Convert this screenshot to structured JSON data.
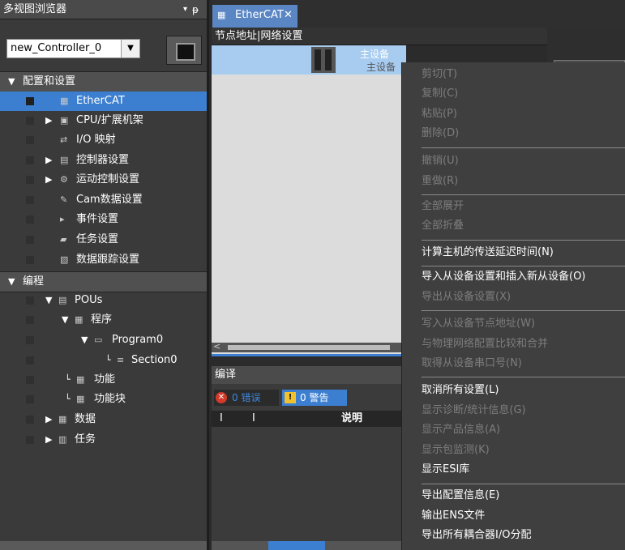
{
  "left_panel": {
    "title": "多视图浏览器",
    "pin_glyph": "▾",
    "pin2_glyph": "ᵽ",
    "controller": "new_Controller_0",
    "controller_arrow": "▼",
    "tree": [
      {
        "label": "配置和设置",
        "twisty": "▼",
        "icon": "",
        "kind": "header"
      },
      {
        "label": "EtherCAT",
        "twisty": "",
        "icon": "▦",
        "kind": "selected"
      },
      {
        "label": "CPU/扩展机架",
        "twisty": "▶",
        "icon": "▣"
      },
      {
        "label": "I/O 映射",
        "twisty": "",
        "icon": "⇄"
      },
      {
        "label": "控制器设置",
        "twisty": "▶",
        "icon": "▤"
      },
      {
        "label": "运动控制设置",
        "twisty": "▶",
        "icon": "⚙"
      },
      {
        "label": "Cam数据设置",
        "twisty": "",
        "icon": "✎"
      },
      {
        "label": "事件设置",
        "twisty": "",
        "icon": "▸"
      },
      {
        "label": "任务设置",
        "twisty": "",
        "icon": "▰"
      },
      {
        "label": "数据跟踪设置",
        "twisty": "",
        "icon": "▧"
      },
      {
        "label": "编程",
        "twisty": "▼",
        "icon": "",
        "kind": "header"
      },
      {
        "label": "POUs",
        "twisty": "▼",
        "icon": "▤"
      },
      {
        "label": "程序",
        "twisty": "▼",
        "icon": "▦"
      },
      {
        "label": "Program0",
        "twisty": "▼",
        "icon": "▭"
      },
      {
        "label": "Section0",
        "twisty": "└",
        "icon": "≡"
      },
      {
        "label": "功能",
        "twisty": "└",
        "icon": "▦"
      },
      {
        "label": "功能块",
        "twisty": "└",
        "icon": "▦"
      },
      {
        "label": "数据",
        "twisty": "▶",
        "icon": "▦"
      },
      {
        "label": "任务",
        "twisty": "▶",
        "icon": "▥"
      }
    ]
  },
  "tab": {
    "label": "EtherCAT",
    "close": "✕",
    "icon": "▦"
  },
  "nodes_bar": "节点地址|网络设置",
  "master": {
    "label1": "主设备",
    "label2": "主设备"
  },
  "scroll_left": "<",
  "compile": {
    "title": "编译",
    "errors_label": "0 错误",
    "errors_icon": "✕",
    "warnings_label": "0 警告",
    "warnings_icon": "!",
    "col1": "I",
    "col2": "I",
    "col3": "说明"
  },
  "context_menu": {
    "items": [
      {
        "label": "剪切(T)",
        "enabled": false
      },
      {
        "label": "复制(C)",
        "enabled": false
      },
      {
        "label": "粘贴(P)",
        "enabled": false
      },
      {
        "label": "删除(D)",
        "enabled": false
      },
      {
        "label": "撤销(U)",
        "enabled": false
      },
      {
        "label": "重做(R)",
        "enabled": false
      },
      {
        "label": "全部展开",
        "enabled": false
      },
      {
        "label": "全部折叠",
        "enabled": false
      },
      {
        "label": "计算主机的传送延迟时间(N)",
        "enabled": true
      },
      {
        "label": "导入从设备设置和插入新从设备(O)",
        "enabled": true
      },
      {
        "label": "导出从设备设置(X)",
        "enabled": false
      },
      {
        "label": "写入从设备节点地址(W)",
        "enabled": false
      },
      {
        "label": "与物理网络配置比较和合并",
        "enabled": false
      },
      {
        "label": "取得从设备串口号(N)",
        "enabled": false
      },
      {
        "label": "取消所有设置(L)",
        "enabled": true
      },
      {
        "label": "显示诊断/统计信息(G)",
        "enabled": false
      },
      {
        "label": "显示产品信息(A)",
        "enabled": false
      },
      {
        "label": "显示包监测(K)",
        "enabled": false
      },
      {
        "label": "显示ESI库",
        "enabled": true
      },
      {
        "label": "导出配置信息(E)",
        "enabled": true
      },
      {
        "label": "输出ENS文件",
        "enabled": true
      },
      {
        "label": "导出所有耦合器I/O分配",
        "enabled": true
      }
    ]
  },
  "colors": {
    "accent": "#3c7fd0",
    "menu_bg": "#3f3f3f",
    "disabled_text": "#7d7d7d"
  }
}
